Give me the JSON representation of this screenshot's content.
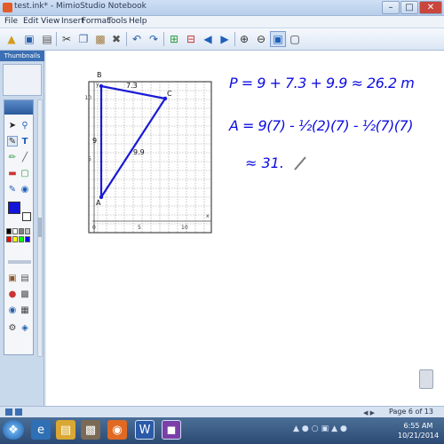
{
  "window": {
    "title": "test.ink* - MimioStudio Notebook",
    "minimize": "–",
    "restore": "□",
    "close": "✕",
    "close_color": "#c9463d"
  },
  "menu": [
    "File",
    "Edit",
    "View",
    "Insert",
    "Format",
    "Tools",
    "Help"
  ],
  "toolbar": {
    "icons": [
      "new-folder-icon",
      "save-icon",
      "print-icon",
      "cut-icon",
      "copy-icon",
      "paste-icon",
      "delete-icon",
      "undo-icon",
      "redo-icon",
      "add-page-icon",
      "delete-page-icon",
      "previous-page-icon",
      "next-page-icon",
      "zoom-in-icon",
      "zoom-out-icon",
      "fit-page-icon",
      "full-screen-icon"
    ]
  },
  "sidebar": {
    "tab_label": "Thumbnails",
    "colors": [
      "#000000",
      "#ffffff",
      "#808080",
      "#c0c0c0",
      "#ff0000",
      "#ffff00",
      "#00ff00",
      "#0000ff"
    ],
    "current_color": "#1414d9"
  },
  "canvas": {
    "grid": {
      "x_ticks": [
        "0",
        "5",
        "10"
      ],
      "y_ticks": [
        "10",
        "5"
      ],
      "x_axis_label": "x",
      "y_axis_label": "y"
    },
    "triangle": {
      "vertices": [
        "A",
        "B",
        "C"
      ],
      "side_labels": [
        "7.3",
        "9",
        "9.9"
      ],
      "stroke_color": "#1a1ad6"
    },
    "handwriting": {
      "line1": "P = 9 + 7.3 + 9.9 ≈ 26.2 m",
      "line2": "A = 9(7) - ½(2)(7) - ½(7)(7)",
      "line3": "≈ 31.",
      "ink_color": "#0d0de0"
    }
  },
  "status": {
    "page_label": "Page 6 of 13"
  },
  "taskbar": {
    "apps": [
      "start-icon",
      "internet-explorer-icon",
      "file-explorer-icon",
      "firefox-icon",
      "word-icon",
      "mimio-icon"
    ],
    "time": "6:55 AM",
    "date": "10/21/2014"
  }
}
